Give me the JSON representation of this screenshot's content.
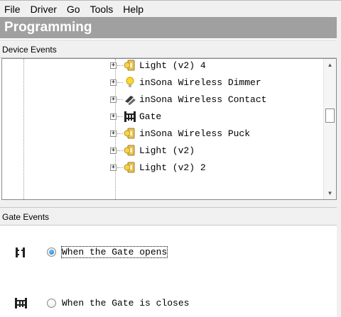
{
  "menu": [
    "File",
    "Driver",
    "Go",
    "Tools",
    "Help"
  ],
  "header": {
    "title": "Programming"
  },
  "device_events": {
    "label": "Device Events",
    "items": [
      {
        "label": "Light (v2) 4",
        "icon": "light-switch-icon"
      },
      {
        "label": "inSona Wireless Dimmer",
        "icon": "bulb-icon"
      },
      {
        "label": "inSona Wireless Contact",
        "icon": "contact-sensor-icon"
      },
      {
        "label": "Gate",
        "icon": "gate-icon"
      },
      {
        "label": "inSona Wireless Puck",
        "icon": "light-switch-icon"
      },
      {
        "label": "Light (v2)",
        "icon": "light-switch-icon"
      },
      {
        "label": "Light (v2) 2",
        "icon": "light-switch-icon"
      }
    ]
  },
  "gate_events": {
    "label": "Gate Events",
    "events": [
      {
        "label": "When the Gate opens",
        "selected": true,
        "icon": "gate-open-icon"
      },
      {
        "label": "When the Gate is closes",
        "selected": false,
        "icon": "gate-closed-icon"
      }
    ]
  },
  "colors": {
    "header_bg": "#a0a0a0",
    "panel_bg": "#f0f0f0",
    "radio_accent": "#1c74c8"
  }
}
